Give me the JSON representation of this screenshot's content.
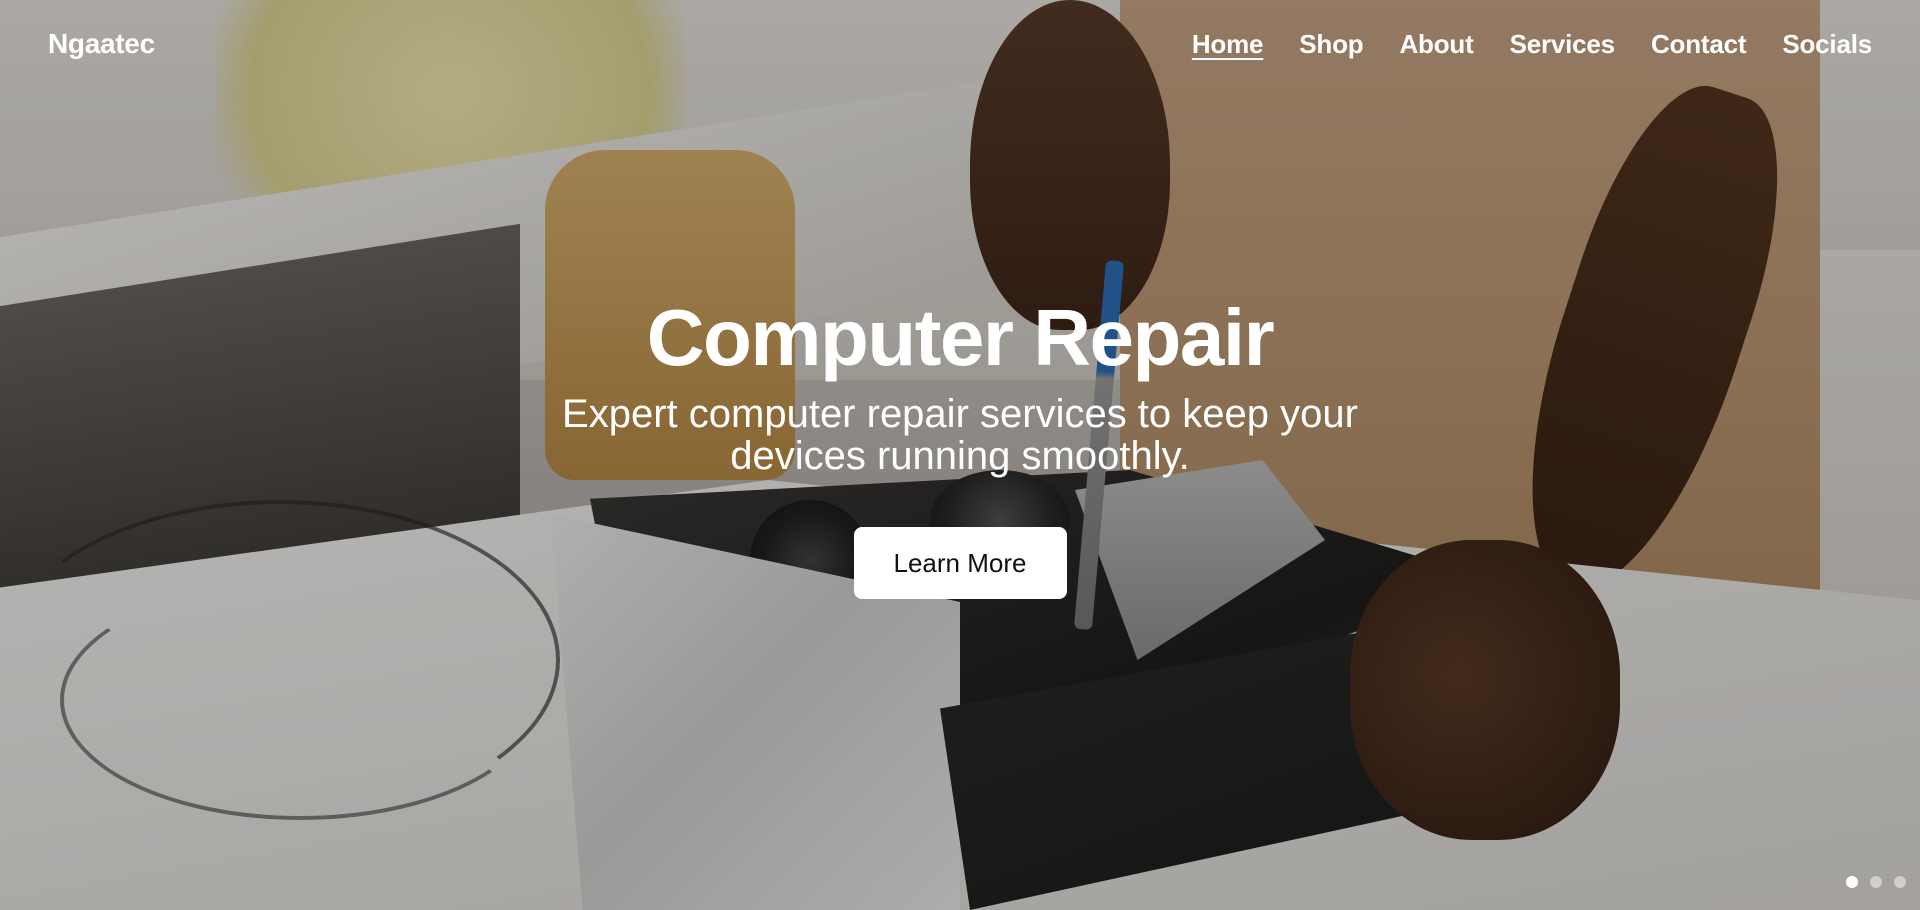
{
  "brand": {
    "name": "Ngaatec"
  },
  "nav": {
    "items": [
      {
        "label": "Home",
        "active": true
      },
      {
        "label": "Shop",
        "active": false
      },
      {
        "label": "About",
        "active": false
      },
      {
        "label": "Services",
        "active": false
      },
      {
        "label": "Contact",
        "active": false
      },
      {
        "label": "Socials",
        "active": false
      }
    ]
  },
  "hero": {
    "title": "Computer Repair",
    "subtitle": "Expert computer repair services to keep your devices running smoothly.",
    "cta_label": "Learn More",
    "background_image": "technician-repairing-desktop-computer-case"
  },
  "slider": {
    "slide_count": 3,
    "active_index": 0
  },
  "colors": {
    "text": "#ffffff",
    "button_bg": "#ffffff",
    "button_text": "#111111",
    "overlay": "rgba(0,0,0,0.26)"
  }
}
